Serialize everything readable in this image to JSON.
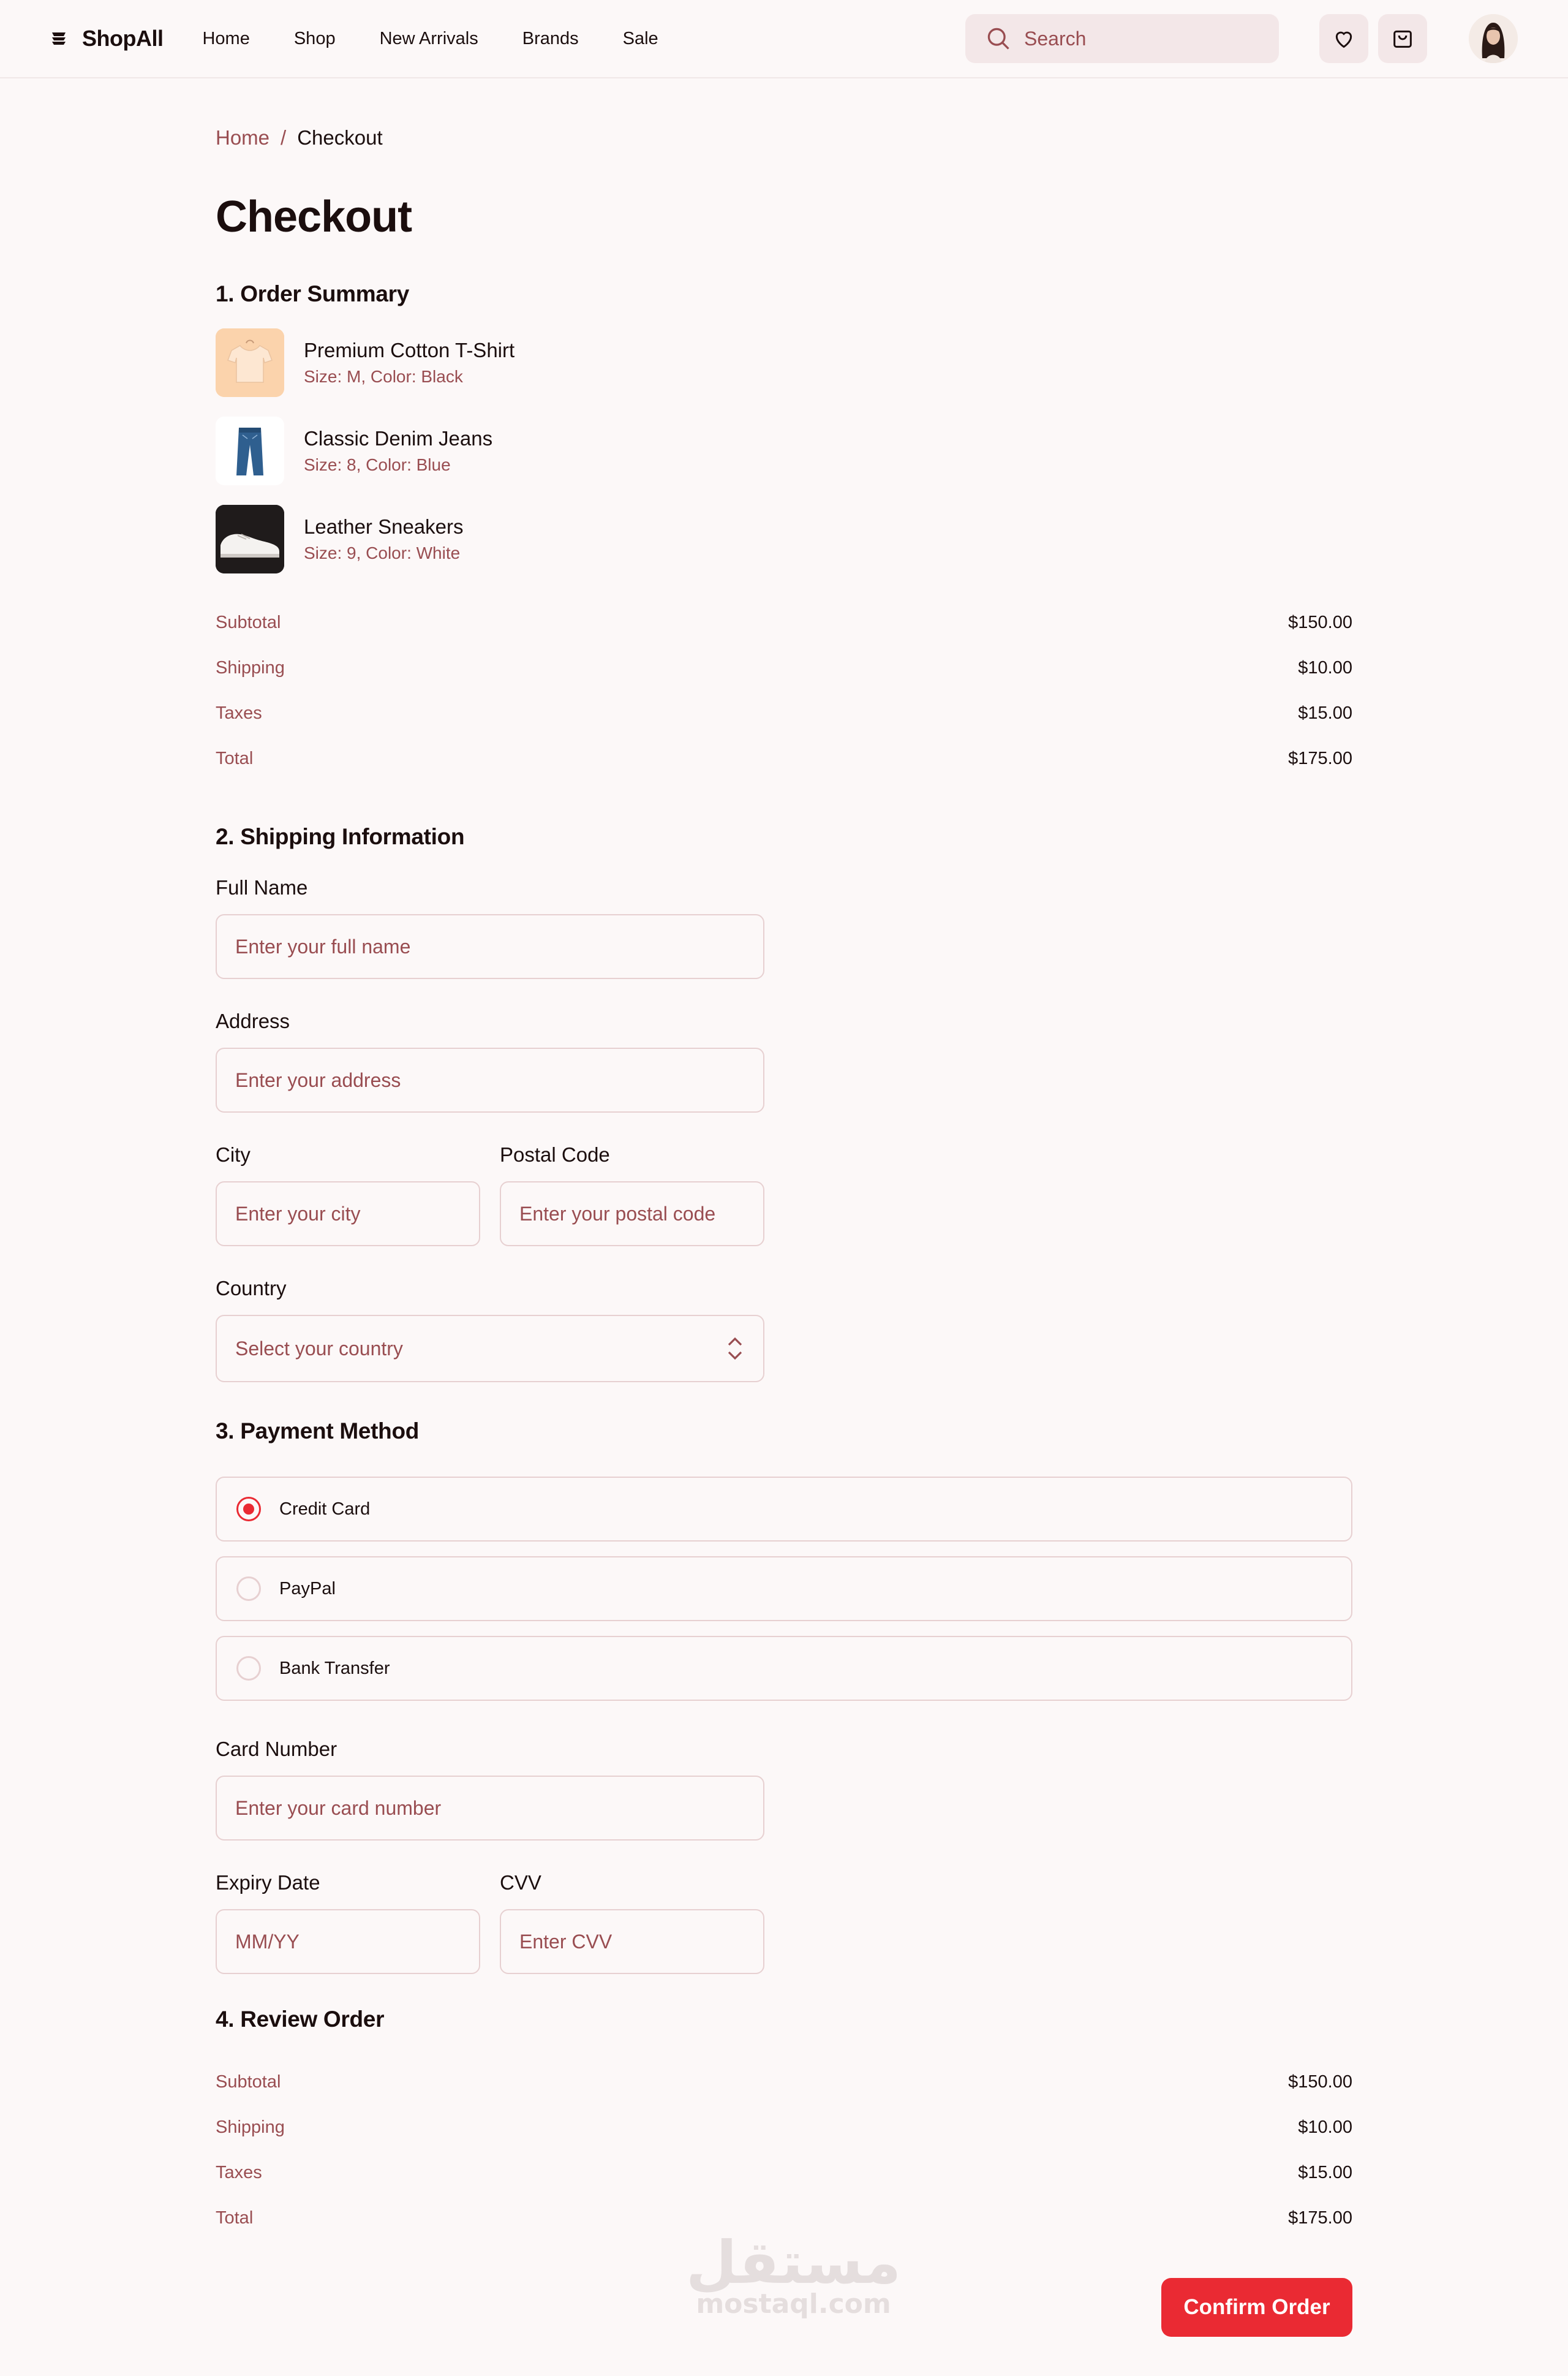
{
  "header": {
    "brand": "ShopAll",
    "nav": [
      "Home",
      "Shop",
      "New Arrivals",
      "Brands",
      "Sale"
    ],
    "search_placeholder": "Search"
  },
  "breadcrumb": {
    "home": "Home",
    "sep": "/",
    "current": "Checkout"
  },
  "page_title": "Checkout",
  "order_summary": {
    "title": "1. Order Summary",
    "items": [
      {
        "name": "Premium Cotton T-Shirt",
        "meta": "Size: M, Color: Black"
      },
      {
        "name": "Classic Denim Jeans",
        "meta": "Size: 8, Color: Blue"
      },
      {
        "name": "Leather Sneakers",
        "meta": "Size: 9, Color: White"
      }
    ],
    "totals": [
      {
        "label": "Subtotal",
        "value": "$150.00"
      },
      {
        "label": "Shipping",
        "value": "$10.00"
      },
      {
        "label": "Taxes",
        "value": "$15.00"
      },
      {
        "label": "Total",
        "value": "$175.00"
      }
    ]
  },
  "shipping": {
    "title": "2. Shipping Information",
    "full_name_label": "Full Name",
    "full_name_placeholder": "Enter your full name",
    "address_label": "Address",
    "address_placeholder": "Enter your address",
    "city_label": "City",
    "city_placeholder": "Enter your city",
    "postal_label": "Postal Code",
    "postal_placeholder": "Enter your postal code",
    "country_label": "Country",
    "country_placeholder": "Select your country"
  },
  "payment": {
    "title": "3. Payment Method",
    "options": [
      {
        "label": "Credit Card",
        "selected": true
      },
      {
        "label": "PayPal",
        "selected": false
      },
      {
        "label": "Bank Transfer",
        "selected": false
      }
    ],
    "card_label": "Card Number",
    "card_placeholder": "Enter your card number",
    "expiry_label": "Expiry Date",
    "expiry_placeholder": "MM/YY",
    "cvv_label": "CVV",
    "cvv_placeholder": "Enter CVV"
  },
  "review": {
    "title": "4. Review Order",
    "totals": [
      {
        "label": "Subtotal",
        "value": "$150.00"
      },
      {
        "label": "Shipping",
        "value": "$10.00"
      },
      {
        "label": "Taxes",
        "value": "$15.00"
      },
      {
        "label": "Total",
        "value": "$175.00"
      }
    ]
  },
  "confirm_label": "Confirm Order",
  "watermark": {
    "arabic": "مستقل",
    "latin": "mostaql.com"
  },
  "colors": {
    "accent": "#ea2a33",
    "muted": "#994d51",
    "border": "#e7d0d1",
    "background": "#fcf8f8"
  }
}
